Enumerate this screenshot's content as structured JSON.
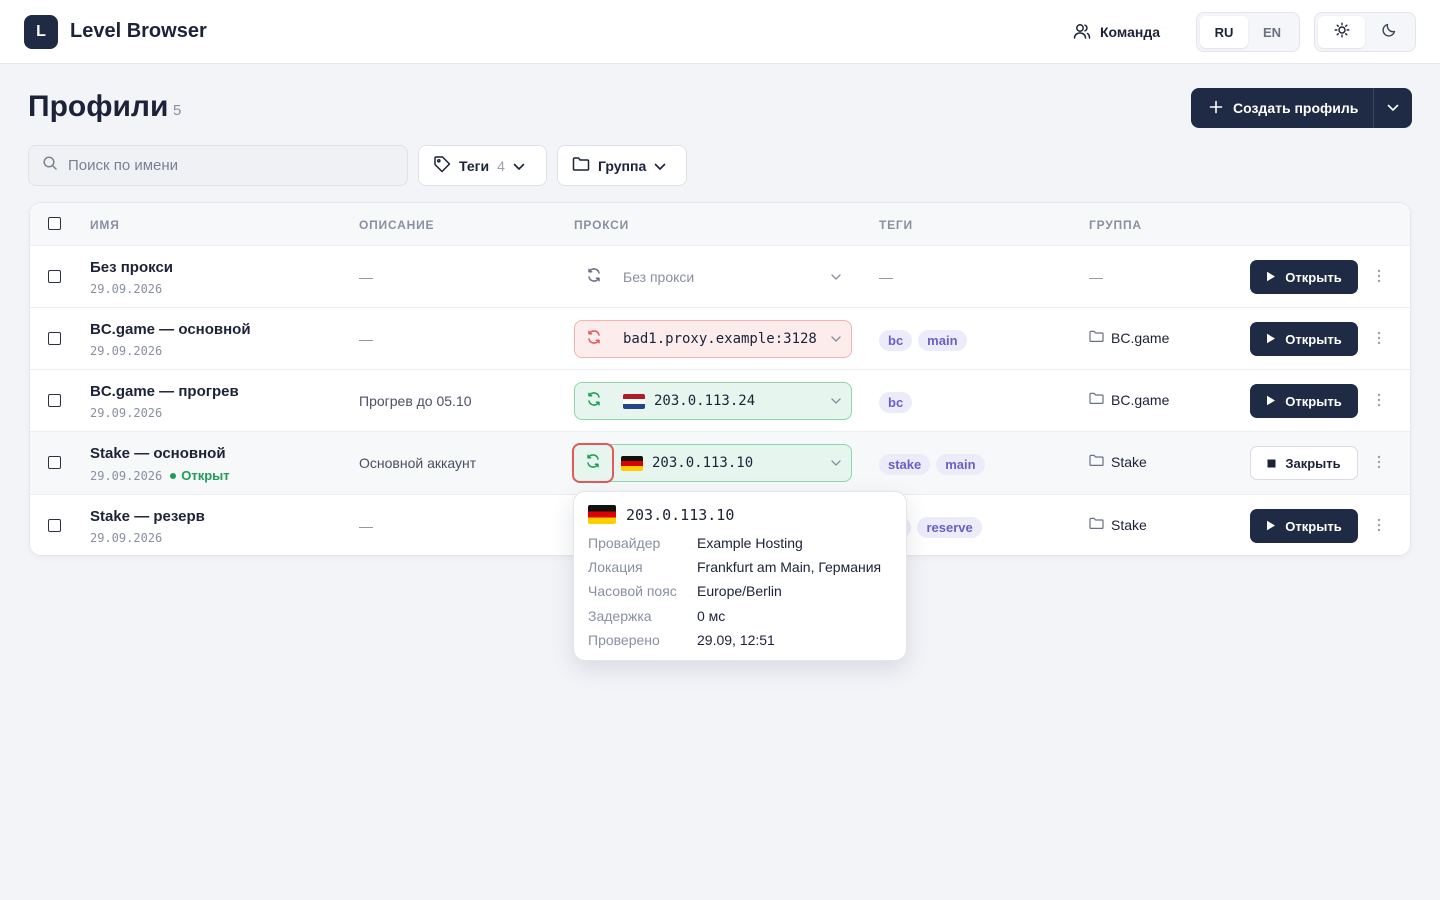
{
  "app": {
    "logo_letter": "L",
    "name": "Level Browser"
  },
  "header": {
    "team_label": "Команда",
    "languages": [
      {
        "label": "RU",
        "active": true
      },
      {
        "label": "EN",
        "active": false
      }
    ]
  },
  "page": {
    "title": "Профили",
    "count": "5"
  },
  "create": {
    "label": "Создать профиль"
  },
  "filters": {
    "search_placeholder": "Поиск по имени",
    "tags_label": "Теги",
    "tags_count": "4",
    "group_label": "Группа"
  },
  "table": {
    "columns": {
      "name": "ИМЯ",
      "description": "ОПИСАНИЕ",
      "proxy": "ПРОКСИ",
      "tags": "ТЕГИ",
      "group": "ГРУППА"
    },
    "dash": "—",
    "rows": [
      {
        "name": "Без прокси",
        "date": "29.09.2026",
        "status": "",
        "description": "—",
        "proxy": "Без прокси",
        "proxy_state": "none",
        "tags": [],
        "group": "—",
        "action": "Открыть"
      },
      {
        "name": "BC.game — основной",
        "date": "29.09.2026",
        "status": "",
        "description": "—",
        "proxy": "bad1.proxy.example:3128",
        "proxy_state": "bad",
        "tags": [
          "bc",
          "main"
        ],
        "group": "BC.game",
        "action": "Открыть"
      },
      {
        "name": "BC.game — прогрев",
        "date": "29.09.2026",
        "status": "",
        "description": "Прогрев до 05.10",
        "proxy": "203.0.113.24",
        "proxy_state": "good",
        "flag": "nl",
        "tags": [
          "bc"
        ],
        "group": "BC.game",
        "action": "Открыть"
      },
      {
        "name": "Stake — основной",
        "date": "29.09.2026",
        "status": "Открыт",
        "description": "Основной аккаунт",
        "proxy": "203.0.113.10",
        "proxy_state": "good",
        "flag": "de",
        "tags": [
          "stake",
          "main"
        ],
        "group": "Stake",
        "action": "Закрыть"
      },
      {
        "name": "Stake — резерв",
        "date": "29.09.2026",
        "status": "",
        "description": "—",
        "proxy": "",
        "proxy_state": "hidden",
        "tags": [
          "ke",
          "reserve"
        ],
        "group": "Stake",
        "action": "Открыть"
      }
    ]
  },
  "popover": {
    "ip": "203.0.113.10",
    "flag": "de",
    "fields": [
      {
        "label": "Провайдер",
        "value": "Example Hosting"
      },
      {
        "label": "Локация",
        "value": "Frankfurt am Main, Германия"
      },
      {
        "label": "Часовой пояс",
        "value": "Europe/Berlin"
      },
      {
        "label": "Задержка",
        "value": "0 мс"
      },
      {
        "label": "Проверено",
        "value": "29.09, 12:51"
      }
    ]
  },
  "colors": {
    "primary": "#1f2a44",
    "tag_bg": "#ecebfa",
    "tag_text": "#6b5fc7",
    "ok": "#1f9d55",
    "error": "#e05a5a"
  }
}
